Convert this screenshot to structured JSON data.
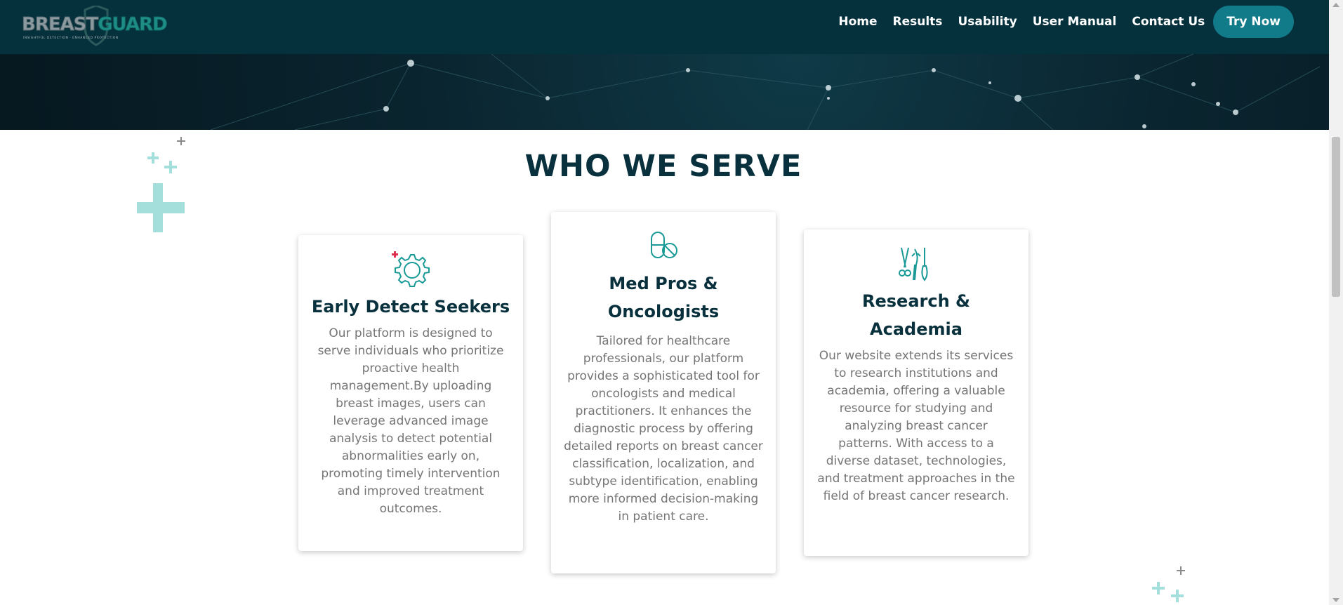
{
  "brand": {
    "logo_left": "BREAST",
    "logo_right": "GUARD",
    "tagline": "INSIGHTFUL DETECTION · ENHANCED PROTECTION"
  },
  "nav": {
    "links": [
      "Home",
      "Results",
      "Usability",
      "User Manual",
      "Contact Us"
    ],
    "cta": "Try Now"
  },
  "section": {
    "title": "WHO WE SERVE"
  },
  "cards": [
    {
      "icon": "gear-icon",
      "title": "Early Detect Seekers",
      "description": "Our platform is designed to serve individuals who prioritize proactive health management.By uploading breast images, users can leverage advanced image analysis to detect potential abnormalities early on, promoting timely intervention and improved treatment outcomes."
    },
    {
      "icon": "pills-icon",
      "title": "Med Pros & Oncologists",
      "description": "Tailored for healthcare professionals, our platform provides a sophisticated tool for oncologists and medical practitioners. It enhances the diagnostic process by offering detailed reports on breast cancer classification, localization, and subtype identification, enabling more informed decision-making in patient care."
    },
    {
      "icon": "surgical-tools-icon",
      "title": "Research & Academia",
      "description": "Our website extends its services to research institutions and academia, offering a valuable resource for studying and analyzing breast cancer patterns. With access to a diverse dataset, technologies, and treatment approaches in the field of breast cancer research."
    }
  ],
  "colors": {
    "navbar": "#05313d",
    "accent": "#117b8a",
    "title": "#08313d",
    "plus_decor": "#9edcd8",
    "icon": "#1a9a96"
  }
}
